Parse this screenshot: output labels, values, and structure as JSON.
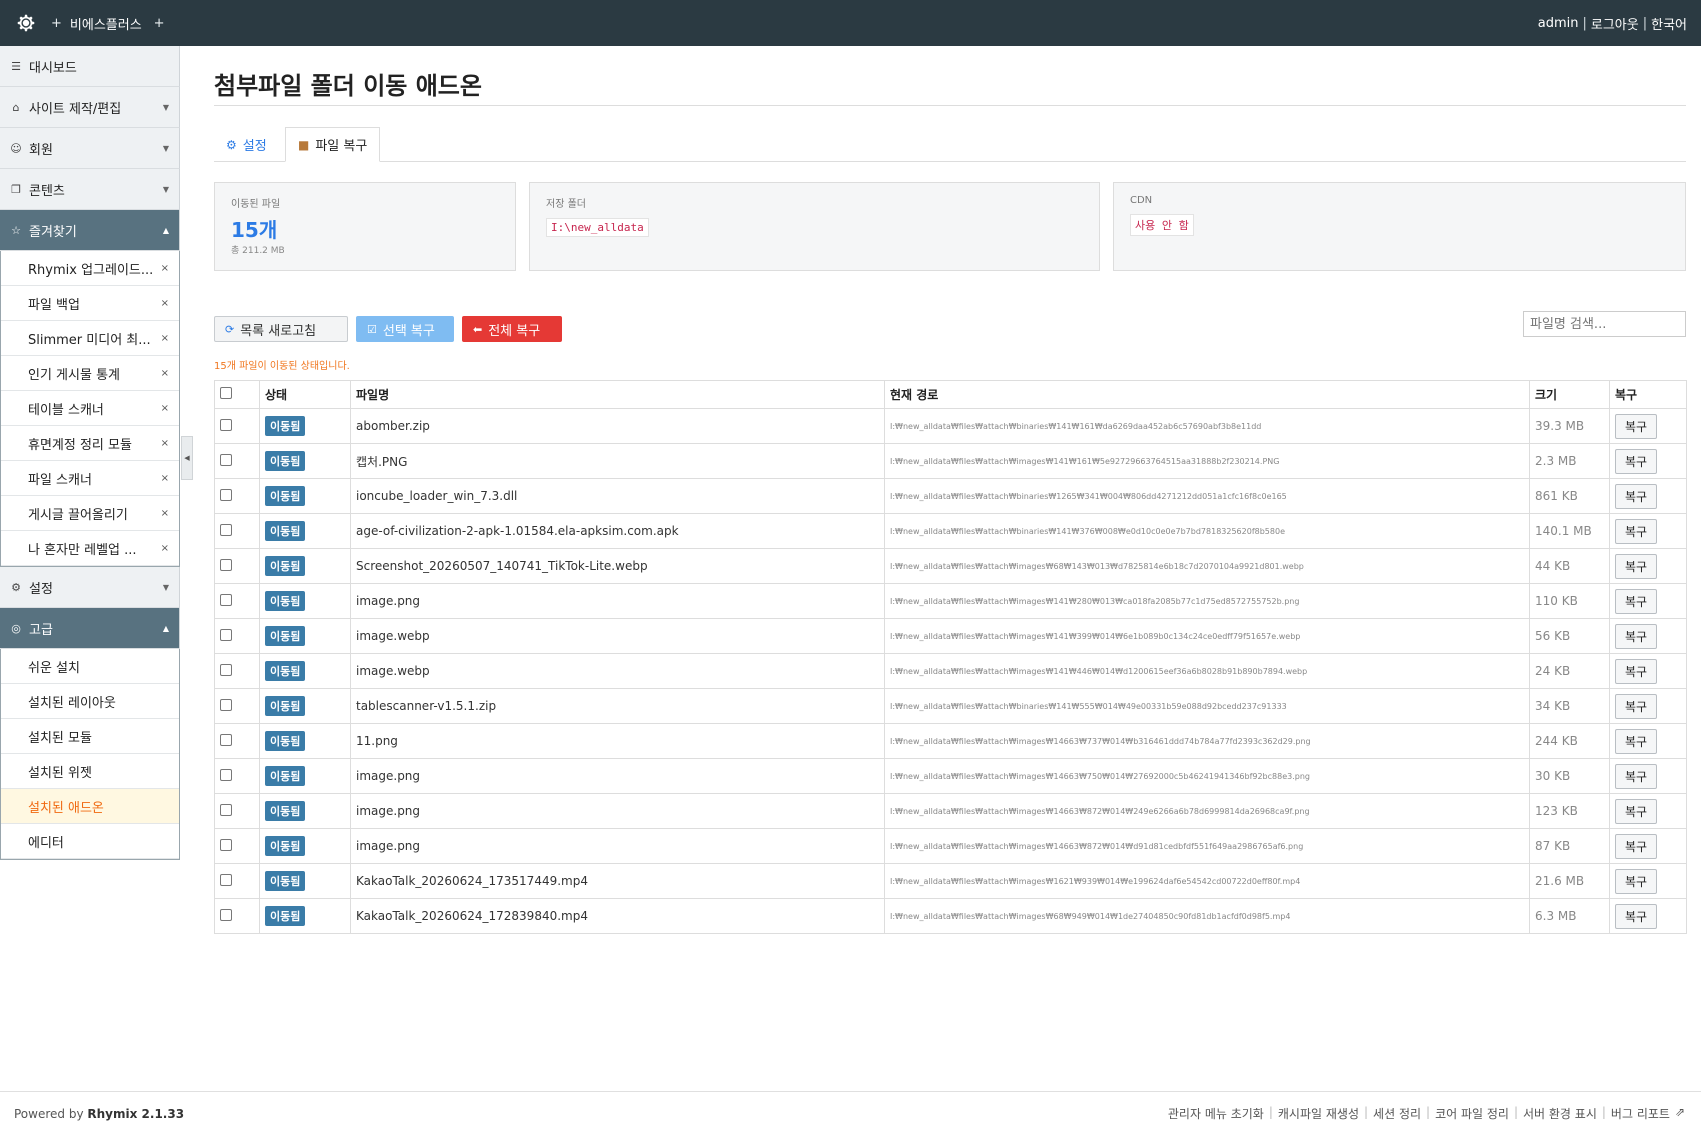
{
  "header": {
    "plus_left": "+",
    "site_name": "비에스플러스",
    "plus_right": "+",
    "user": "admin",
    "logout": "로그아웃",
    "language": "한국어",
    "sep": "|"
  },
  "sidebar": {
    "main_items": [
      {
        "label": "대시보드",
        "icon": "list-icon"
      },
      {
        "label": "사이트 제작/편집",
        "icon": "home-icon"
      },
      {
        "label": "회원",
        "icon": "users-icon"
      },
      {
        "label": "콘텐츠",
        "icon": "copy-icon"
      }
    ],
    "favorites": {
      "label": "즐겨찾기",
      "items": [
        "Rhymix 업그레이드...",
        "파일 백업",
        "Slimmer 미디어 최...",
        "인기 게시물 통계",
        "테이블 스캐너",
        "휴면계정 정리 모듈",
        "파일 스캐너",
        "게시글 끌어올리기",
        "나 혼자만 레벨업 ..."
      ],
      "remove": "×"
    },
    "settings": {
      "label": "설정"
    },
    "advanced": {
      "label": "고급",
      "items": [
        "쉬운 설치",
        "설치된 레이아웃",
        "설치된 모듈",
        "설치된 위젯",
        "설치된 애드온",
        "에디터"
      ],
      "selected_index": 4
    }
  },
  "page": {
    "title": "첨부파일 폴더 이동 애드온",
    "tabs": [
      {
        "label": "설정",
        "icon": "gear-small-icon"
      },
      {
        "label": "파일 복구",
        "icon": "box-icon"
      }
    ],
    "cards": {
      "moved": {
        "label": "이동된 파일",
        "value": "15개",
        "sub": "총 211.2 MB"
      },
      "folder": {
        "label": "저장 폴더",
        "value": "I:\\new_alldata"
      },
      "cdn": {
        "label": "CDN",
        "value": "사용 안 함"
      }
    },
    "toolbar": {
      "refresh": "목록 새로고침",
      "select_restore": "선택 복구",
      "all_restore": "전체 복구",
      "search_placeholder": "파일명 검색..."
    },
    "notice": "15개 파일이 이동된 상태입니다.",
    "table": {
      "headers": {
        "status": "상태",
        "filename": "파일명",
        "path": "현재 경로",
        "size": "크기",
        "restore": "복구"
      },
      "status_label": "이동됨",
      "restore_label": "복구",
      "rows": [
        {
          "name": "abomber.zip",
          "path": "I:₩new_alldata₩files₩attach₩binaries₩141₩161₩da6269daa452ab6c57690abf3b8e11dd",
          "size": "39.3 MB"
        },
        {
          "name": "캡처.PNG",
          "path": "I:₩new_alldata₩files₩attach₩images₩141₩161₩5e92729663764515aa31888b2f230214.PNG",
          "size": "2.3 MB"
        },
        {
          "name": "ioncube_loader_win_7.3.dll",
          "path": "I:₩new_alldata₩files₩attach₩binaries₩1265₩341₩004₩806dd4271212dd051a1cfc16f8c0e165",
          "size": "861 KB"
        },
        {
          "name": "age-of-civilization-2-apk-1.01584.ela-apksim.com.apk",
          "path": "I:₩new_alldata₩files₩attach₩binaries₩141₩376₩008₩e0d10c0e0e7b7bd7818325620f8b580e",
          "size": "140.1 MB"
        },
        {
          "name": "Screenshot_20260507_140741_TikTok-Lite.webp",
          "path": "I:₩new_alldata₩files₩attach₩images₩68₩143₩013₩d7825814e6b18c7d2070104a9921d801.webp",
          "size": "44 KB"
        },
        {
          "name": "image.png",
          "path": "I:₩new_alldata₩files₩attach₩images₩141₩280₩013₩ca018fa2085b77c1d75ed8572755752b.png",
          "size": "110 KB"
        },
        {
          "name": "image.webp",
          "path": "I:₩new_alldata₩files₩attach₩images₩141₩399₩014₩6e1b089b0c134c24ce0edff79f51657e.webp",
          "size": "56 KB"
        },
        {
          "name": "image.webp",
          "path": "I:₩new_alldata₩files₩attach₩images₩141₩446₩014₩d1200615eef36a6b8028b91b890b7894.webp",
          "size": "24 KB"
        },
        {
          "name": "tablescanner-v1.5.1.zip",
          "path": "I:₩new_alldata₩files₩attach₩binaries₩141₩555₩014₩49e00331b59e088d92bcedd237c91333",
          "size": "34 KB"
        },
        {
          "name": "11.png",
          "path": "I:₩new_alldata₩files₩attach₩images₩14663₩737₩014₩b316461ddd74b784a77fd2393c362d29.png",
          "size": "244 KB"
        },
        {
          "name": "image.png",
          "path": "I:₩new_alldata₩files₩attach₩images₩14663₩750₩014₩27692000c5b46241941346bf92bc88e3.png",
          "size": "30 KB"
        },
        {
          "name": "image.png",
          "path": "I:₩new_alldata₩files₩attach₩images₩14663₩872₩014₩249e6266a6b78d6999814da26968ca9f.png",
          "size": "123 KB"
        },
        {
          "name": "image.png",
          "path": "I:₩new_alldata₩files₩attach₩images₩14663₩872₩014₩d91d81cedbfdf551f649aa2986765af6.png",
          "size": "87 KB"
        },
        {
          "name": "KakaoTalk_20260624_173517449.mp4",
          "path": "I:₩new_alldata₩files₩attach₩images₩1621₩939₩014₩e199624daf6e54542cd00722d0eff80f.mp4",
          "size": "21.6 MB"
        },
        {
          "name": "KakaoTalk_20260624_172839840.mp4",
          "path": "I:₩new_alldata₩files₩attach₩images₩68₩949₩014₩1de27404850c90fd81db1acfdf0d98f5.mp4",
          "size": "6.3 MB"
        }
      ]
    }
  },
  "footer": {
    "powered_prefix": "Powered by",
    "powered_brand": "Rhymix 2.1.33",
    "links": [
      "관리자 메뉴 초기화",
      "캐시파일 재생성",
      "세션 정리",
      "코어 파일 정리",
      "서버 환경 표시",
      "버그 리포트"
    ],
    "sep": "|"
  },
  "colors": {
    "header_bg": "#2b3a42",
    "accent": "#2c7be5",
    "danger": "#e53935",
    "badge": "#3a7ca8",
    "selected": "#f06a12"
  }
}
